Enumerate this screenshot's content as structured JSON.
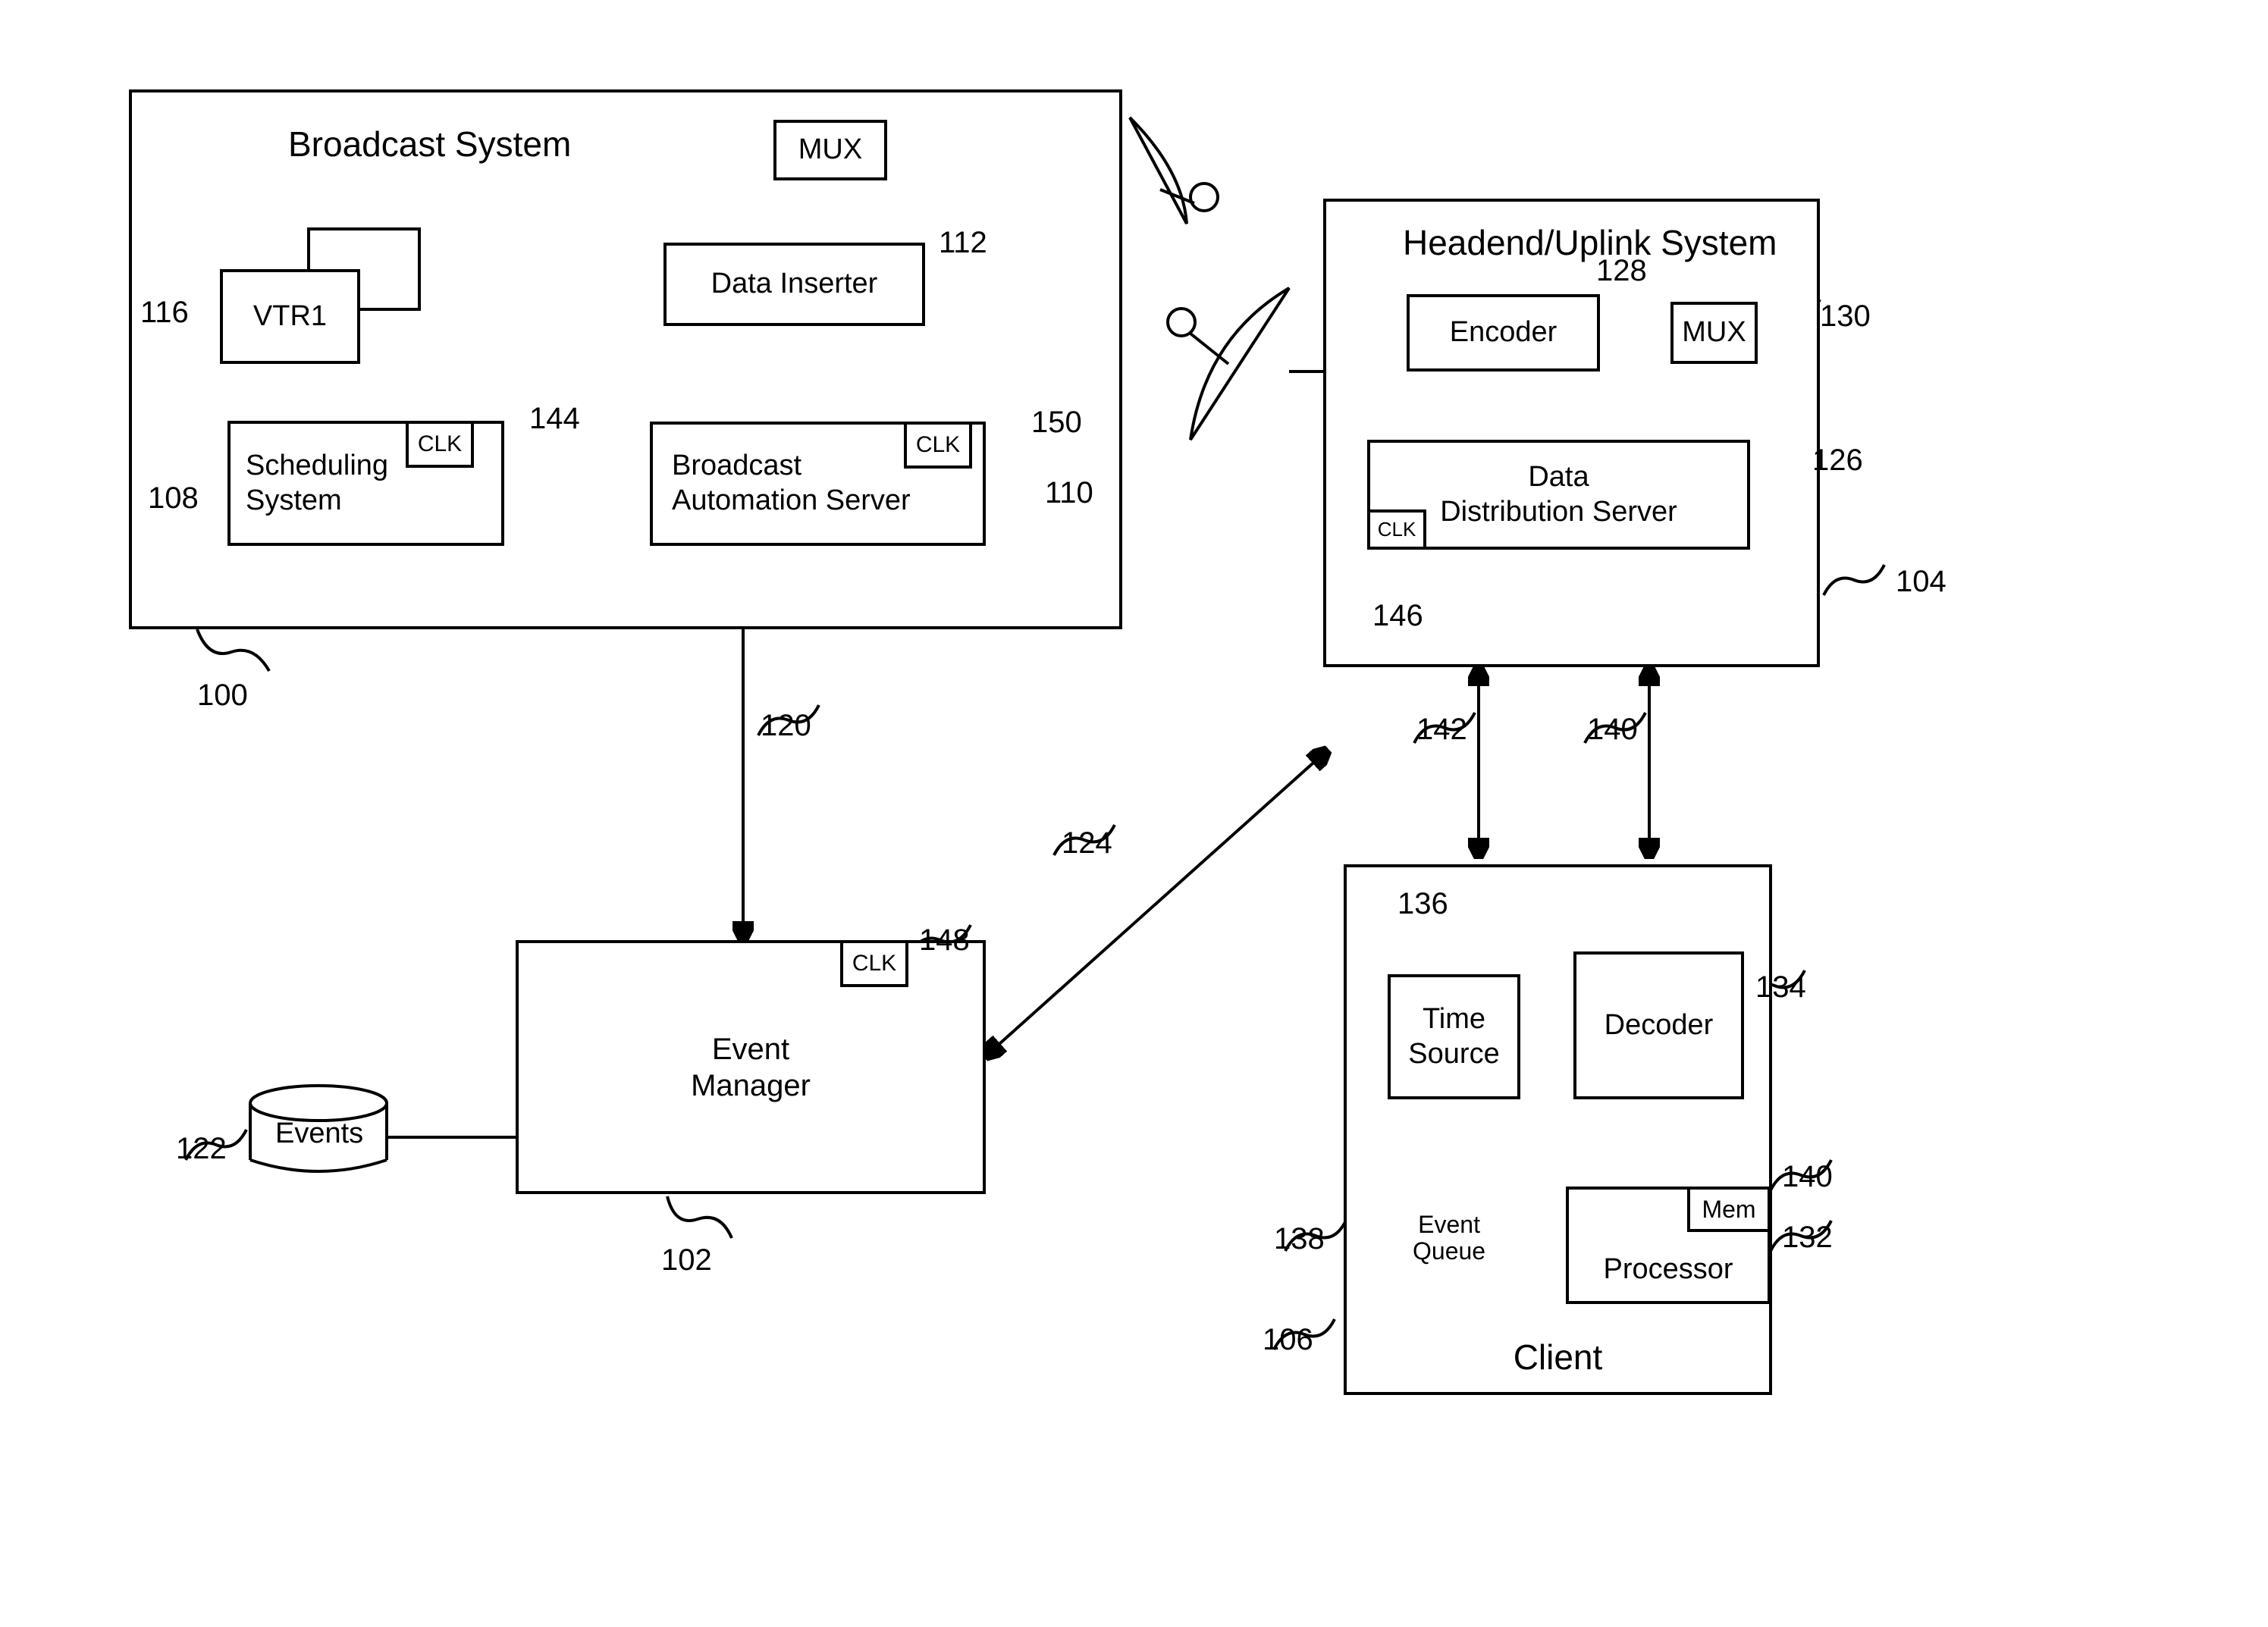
{
  "diagram": {
    "broadcast_system": {
      "title": "Broadcast System",
      "ref": "100",
      "vtr1": {
        "label": "VTR1",
        "ref": "116"
      },
      "scheduling_system": {
        "label": "Scheduling\nSystem",
        "ref": "108",
        "clk": "CLK",
        "clk_ref": "144"
      },
      "broadcast_automation": {
        "label": "Broadcast\nAutomation Server",
        "ref": "110",
        "clk": "CLK",
        "clk_ref": "150"
      },
      "data_inserter": {
        "label": "Data Inserter",
        "ref": "112"
      },
      "mux": {
        "label": "MUX"
      }
    },
    "event_manager": {
      "label": "Event\nManager",
      "ref": "102",
      "clk": "CLK",
      "clk_ref": "148",
      "events_db": {
        "label": "Events",
        "ref": "122"
      }
    },
    "link_120": "120",
    "link_124": "124",
    "headend": {
      "title": "Headend/Uplink System",
      "ref": "104",
      "encoder": {
        "label": "Encoder",
        "ref": "128"
      },
      "mux": {
        "label": "MUX",
        "ref": "130"
      },
      "data_dist": {
        "label": "Data\nDistribution Server",
        "ref": "126",
        "clk": "CLK",
        "clk_ref": "146"
      }
    },
    "link_140": "140",
    "link_142": "142",
    "client": {
      "title": "Client",
      "ref": "106",
      "time_source": {
        "label": "Time\nSource",
        "ref": "136"
      },
      "decoder": {
        "label": "Decoder",
        "ref": "134"
      },
      "processor": {
        "label": "Processor",
        "ref": "132",
        "mem": "Mem",
        "mem_ref": "140"
      },
      "event_queue": {
        "label": "Event\nQueue",
        "ref": "138"
      }
    }
  }
}
